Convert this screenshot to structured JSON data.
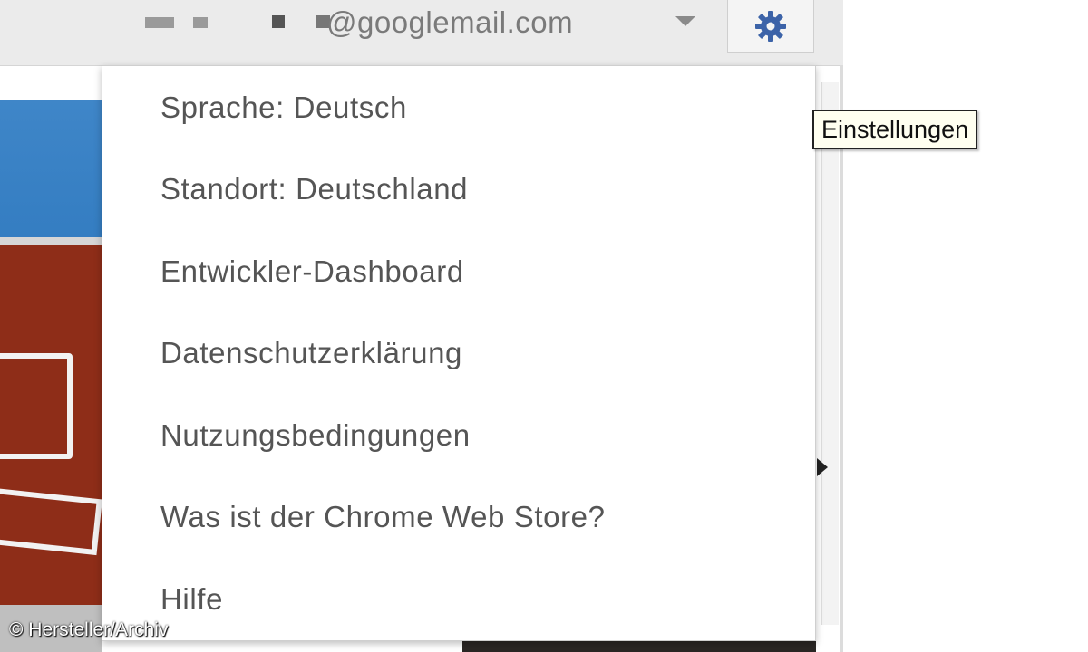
{
  "header": {
    "account_email": "@googlemail.com",
    "settings_tooltip": "Einstellungen"
  },
  "icons": {
    "settings": "gear-icon",
    "account_menu": "chevron-down-icon"
  },
  "colors": {
    "gear": "#3c63a8",
    "menu_text": "#555555"
  },
  "menu": {
    "items": [
      {
        "label": "Sprache: Deutsch"
      },
      {
        "label": "Standort: Deutschland"
      },
      {
        "label": "Entwickler-Dashboard"
      },
      {
        "label": "Datenschutzerklärung"
      },
      {
        "label": "Nutzungsbedingungen"
      },
      {
        "label": "Was ist der Chrome Web Store?"
      },
      {
        "label": "Hilfe"
      }
    ]
  },
  "credit": "© Hersteller/Archiv"
}
